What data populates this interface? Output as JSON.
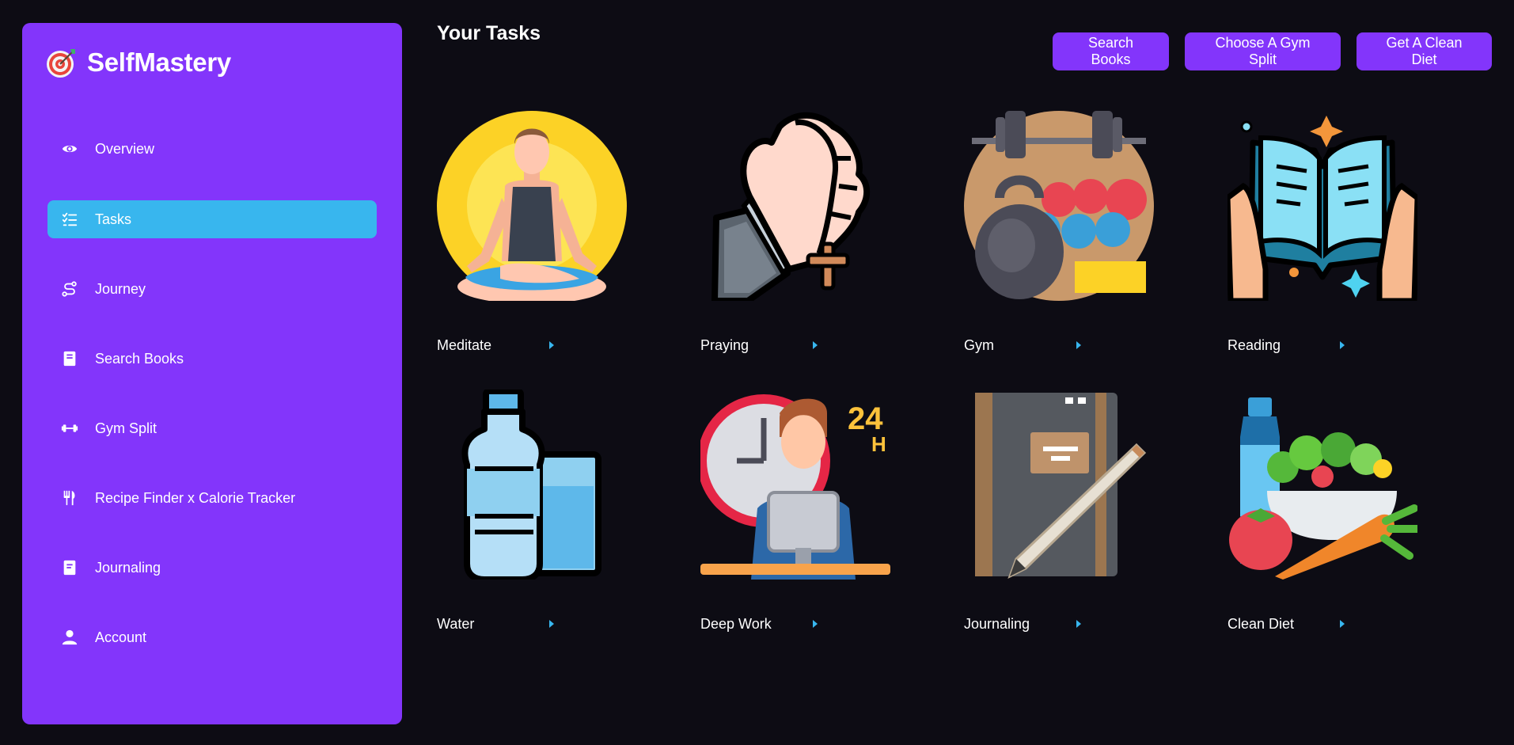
{
  "brand": {
    "name": "SelfMastery",
    "icon": "target-icon"
  },
  "sidebar": {
    "items": [
      {
        "label": "Overview",
        "icon": "eye-icon"
      },
      {
        "label": "Tasks",
        "icon": "checklist-icon",
        "active": true
      },
      {
        "label": "Journey",
        "icon": "route-icon"
      },
      {
        "label": "Search Books",
        "icon": "book-icon"
      },
      {
        "label": "Gym Split",
        "icon": "dumbbell-icon"
      },
      {
        "label": "Recipe Finder x Calorie Tracker",
        "icon": "utensils-icon"
      },
      {
        "label": "Journaling",
        "icon": "journal-icon"
      },
      {
        "label": "Account",
        "icon": "user-icon"
      }
    ]
  },
  "main": {
    "title": "Your Tasks",
    "buttons": {
      "search_books": "Search Books",
      "gym_split": "Choose A Gym Split",
      "clean_diet": "Get A Clean Diet"
    },
    "tasks": [
      {
        "label": "Meditate",
        "icon": "meditation-icon"
      },
      {
        "label": "Praying",
        "icon": "praying-hands-icon"
      },
      {
        "label": "Gym",
        "icon": "gym-weights-icon"
      },
      {
        "label": "Reading",
        "icon": "open-book-icon"
      },
      {
        "label": "Water",
        "icon": "water-bottle-icon"
      },
      {
        "label": "Deep Work",
        "icon": "deep-work-icon"
      },
      {
        "label": "Journaling",
        "icon": "notebook-pencil-icon"
      },
      {
        "label": "Clean Diet",
        "icon": "salad-icon"
      }
    ]
  },
  "colors": {
    "background": "#0d0c14",
    "sidebar": "#8335fb",
    "active": "#38b6ee",
    "button": "#8335fb"
  }
}
